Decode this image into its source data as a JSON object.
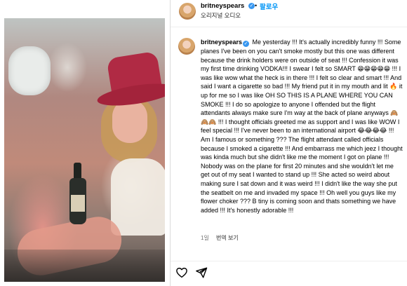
{
  "post": {
    "username": "britneyspears",
    "verified_mark": "✓",
    "follow_label": "팔로우",
    "separator": "•",
    "audio_label": "오리지널 오디오"
  },
  "caption": {
    "username": "britneyspears",
    "text": "Me yesterday !!! It's actually incredibly funny !!! Some planes I've been on you can't smoke mostly but this one was different because the drink holders were on outside of seat !!! Confession it was my first time drinking VODKA!!! I swear I felt so SMART 😁😁😁😁😁 !!! I was like wow what the heck is in there !!! I felt so clear and smart !!! And said I want a cigarette so bad !!! My friend put it in my mouth and lit 🔥 it up for me so I was like OH SO THIS IS A PLANE WHERE YOU CAN SMOKE !!! I do so apologize to anyone I offended but the flight attendants always make sure I'm way at the back of plane anyways 🙈🙈🙈 !!! I thought officials greeted me as support and I was like WOW I feel special !!! I've never been to an international airport 😂😂😂😂 !!! Am I famous or something ??? The flight attendant called officials because I smoked a cigarette !!! And embarrass me which jeez I thought was kinda much but she didn't like me the moment I got on plane !!! Nobody was on the plane for first 20 minutes and she wouldn't let me get out of my seat I wanted to stand up !!! She acted so weird about making sure I sat down and it was weird !!! I didn't like the way she put the seatbelt on me and invaded my space !!! Oh well you guys like my flower choker ??? B tiny is coming soon and thats something we have added !!! It's honestly adorable !!!"
  },
  "meta": {
    "time_ago": "1일",
    "translate_label": "번역 보기"
  },
  "actions": {
    "like_icon": "heart-icon",
    "share_icon": "paper-plane-icon"
  },
  "colors": {
    "accent": "#0095f6",
    "verified": "#3897f0",
    "muted": "#737373"
  }
}
